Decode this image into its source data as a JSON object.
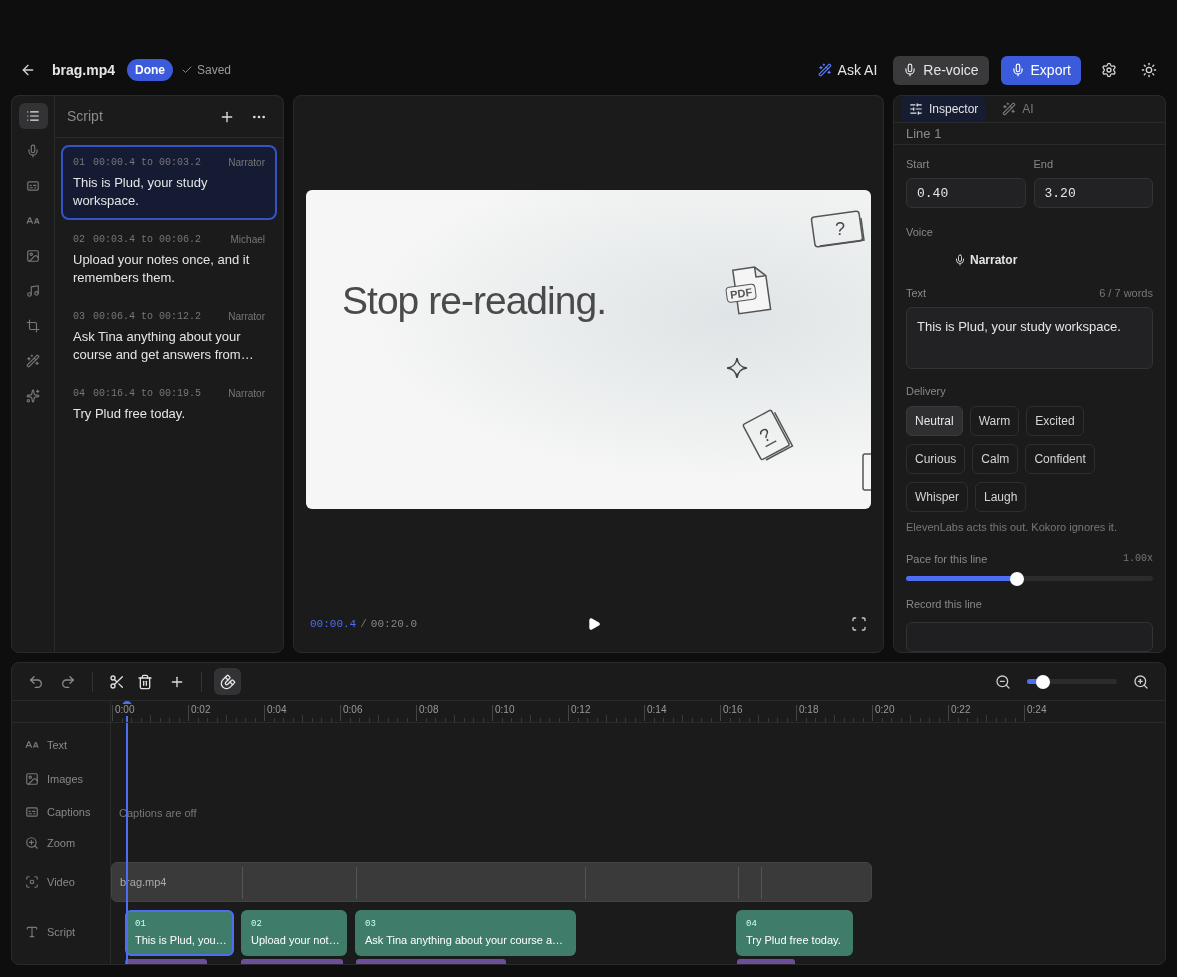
{
  "header": {
    "file_name": "brag.mp4",
    "status": "Done",
    "saved": "Saved",
    "actions": [
      {
        "kind": "ai",
        "label": "Ask AI"
      },
      {
        "kind": "revoice",
        "label": "Re-voice"
      },
      {
        "kind": "export",
        "label": "Export"
      }
    ]
  },
  "rail": [
    {
      "kind": "list",
      "selected": true
    },
    {
      "kind": "mic",
      "selected": false
    },
    {
      "kind": "captions",
      "selected": false
    },
    {
      "kind": "text",
      "selected": false
    },
    {
      "kind": "image",
      "selected": false
    },
    {
      "kind": "music",
      "selected": false
    },
    {
      "kind": "crop",
      "selected": false
    },
    {
      "kind": "wand",
      "selected": false
    },
    {
      "kind": "sparkle",
      "selected": false
    }
  ],
  "script": {
    "title": "Script",
    "lines": [
      {
        "number": "01",
        "timing": "00:00.4 to 00:03.2",
        "speaker": "Narrator",
        "text": "This is Plud, your study workspace.",
        "selected": true
      },
      {
        "number": "02",
        "timing": "00:03.4 to 00:06.2",
        "speaker": "Michael",
        "text": "Upload your notes once, and it remembers them.",
        "selected": false
      },
      {
        "number": "03",
        "timing": "00:06.4 to 00:12.2",
        "speaker": "Narrator",
        "text": "Ask Tina anything about your course and get answers from…",
        "selected": false
      },
      {
        "number": "04",
        "timing": "00:16.4 to 00:19.5",
        "speaker": "Narrator",
        "text": "Try Plud free today.",
        "selected": false
      }
    ]
  },
  "preview": {
    "slide_title": "Stop re-reading.",
    "file_badge": "PDF",
    "card_marks": [
      "?",
      "?"
    ],
    "current_time": "00:00.4",
    "separator": "/",
    "total_time": "00:20.0"
  },
  "inspector": {
    "tabs": [
      {
        "label": "Inspector",
        "selected": true
      },
      {
        "label": "AI",
        "selected": false
      }
    ],
    "heading": "Line 1",
    "start_label": "Start",
    "start_value": "0.40",
    "end_label": "End",
    "end_value": "3.20",
    "voice_label": "Voice",
    "voice": "Narrator",
    "text_label": "Text",
    "word_count": "6 / 7 words",
    "text_value": "This is Plud, your study workspace.",
    "delivery_label": "Delivery",
    "delivery": [
      {
        "label": "Neutral",
        "selected": true
      },
      {
        "label": "Warm",
        "selected": false
      },
      {
        "label": "Excited",
        "selected": false
      },
      {
        "label": "Curious",
        "selected": false
      },
      {
        "label": "Calm",
        "selected": false
      },
      {
        "label": "Confident",
        "selected": false
      },
      {
        "label": "Whisper",
        "selected": false
      },
      {
        "label": "Laugh",
        "selected": false
      }
    ],
    "delivery_note": "ElevenLabs acts this out. Kokoro ignores it.",
    "pace_label": "Pace for this line",
    "pace_value": "1.00x",
    "pace": {
      "level": 0.45
    },
    "record_label": "Record this line"
  },
  "timeline": {
    "snap": {
      "on": true
    },
    "zoom": {
      "level": 0.18
    },
    "ticks": [
      "0:00",
      "0:02",
      "0:04",
      "0:06",
      "0:08",
      "0:10",
      "0:12",
      "0:14",
      "0:16",
      "0:18",
      "0:20",
      "0:22",
      "0:24"
    ],
    "tracks": [
      {
        "kind": "text",
        "label": "Text"
      },
      {
        "kind": "images",
        "label": "Images"
      },
      {
        "kind": "captions",
        "label": "Captions",
        "note": "Captions are off"
      },
      {
        "kind": "zoom",
        "label": "Zoom"
      },
      {
        "kind": "video",
        "label": "Video",
        "clip": "brag.mp4"
      },
      {
        "kind": "script",
        "label": "Script",
        "clips": [
          {
            "number": "01",
            "text": "This is Plud, you…",
            "selected": true
          },
          {
            "number": "02",
            "text": "Upload your not…",
            "selected": false
          },
          {
            "number": "03",
            "text": "Ask Tina anything about your course a…",
            "selected": false
          },
          {
            "number": "04",
            "text": "Try Plud free today.",
            "selected": false
          }
        ]
      }
    ]
  }
}
